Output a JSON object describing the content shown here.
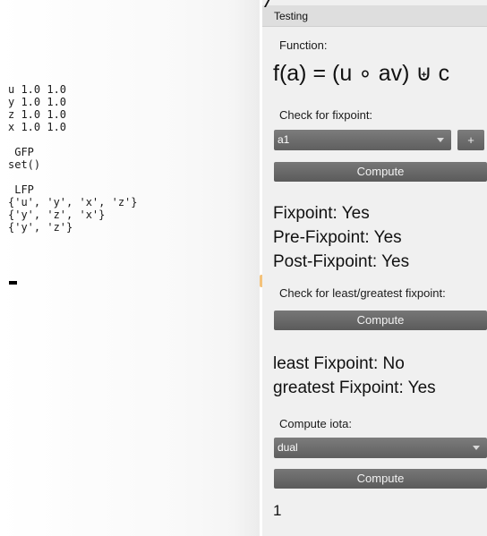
{
  "console": {
    "lines": [
      "u 1.0 1.0",
      "y 1.0 1.0",
      "z 1.0 1.0",
      "x 1.0 1.0",
      "",
      " GFP",
      "set()",
      "",
      " LFP",
      "{'u', 'y', 'x', 'z'}",
      "{'y', 'z', 'x'}",
      "{'y', 'z'}"
    ]
  },
  "panel": {
    "title": "Testing",
    "function_label": "Function:",
    "formula": "f(a) = (u ∘ av) ⊎ c",
    "fixpoint_section": {
      "label": "Check for fixpoint:",
      "selected": "a1",
      "plus_label": "+",
      "compute_label": "Compute",
      "results": {
        "fixpoint": "Fixpoint: Yes",
        "pre_fixpoint": "Pre-Fixpoint: Yes",
        "post_fixpoint": "Post-Fixpoint: Yes"
      }
    },
    "least_greatest_section": {
      "label": "Check for least/greatest fixpoint:",
      "compute_label": "Compute",
      "results": {
        "least": "least Fixpoint: No",
        "greatest": "greatest Fixpoint: Yes"
      }
    },
    "iota_section": {
      "label": "Compute iota:",
      "selected": "dual",
      "compute_label": "Compute",
      "result": "1"
    }
  }
}
